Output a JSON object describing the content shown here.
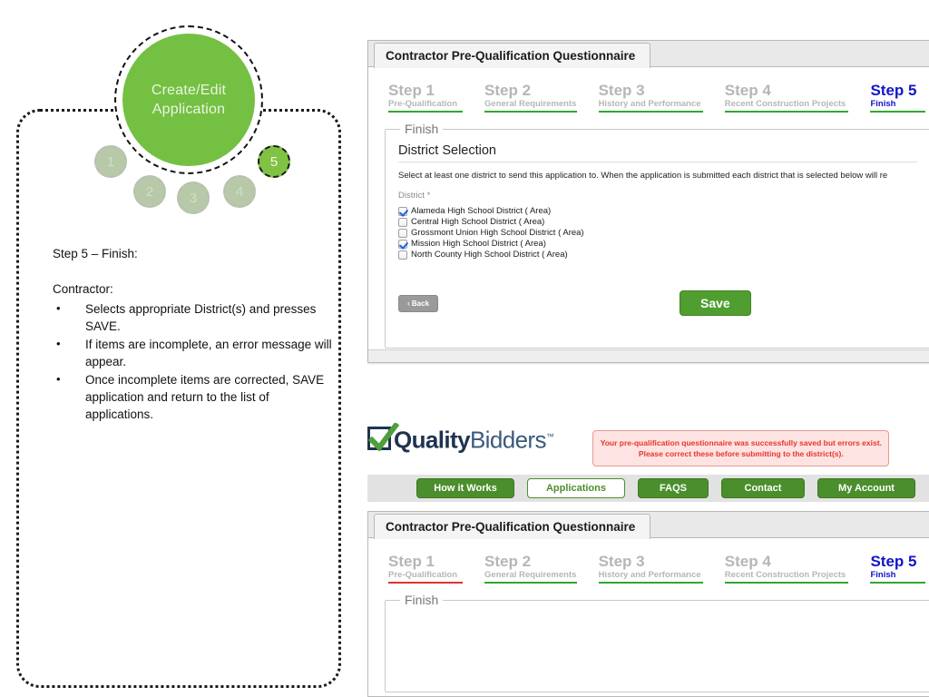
{
  "diagram": {
    "center_label_line1": "Create/Edit",
    "center_label_line2": "Application",
    "steps": [
      "1",
      "2",
      "3",
      "4",
      "5"
    ],
    "active_step": "5",
    "active_color": "#80c244",
    "inactive_color": "#b7c9a8",
    "center_color": "#74c043"
  },
  "callout": {
    "heading": "Step 5 – Finish:",
    "role": "Contractor:",
    "bullets": [
      "Selects appropriate District(s) and presses SAVE.",
      "If items are incomplete, an error message will appear.",
      "Once incomplete items are corrected, SAVE application and return to the list of applications."
    ]
  },
  "top_panel": {
    "tab_label": "Contractor Pre-Qualification Questionnaire",
    "steps": [
      {
        "title": "Step 1",
        "sub": "Pre-Qualification",
        "state": "complete"
      },
      {
        "title": "Step 2",
        "sub": "General Requirements",
        "state": "complete"
      },
      {
        "title": "Step 3",
        "sub": "History and Performance",
        "state": "complete"
      },
      {
        "title": "Step 4",
        "sub": "Recent Construction Projects",
        "state": "complete"
      },
      {
        "title": "Step 5",
        "sub": "Finish",
        "state": "current"
      }
    ],
    "fieldset_legend": "Finish",
    "section_title": "District Selection",
    "section_desc": "Select at least one district to send this application to. When the application is submitted each district that is selected below will re",
    "field_label": "District *",
    "districts": [
      {
        "label": "Alameda High School District ( Area)",
        "checked": true
      },
      {
        "label": "Central High School District ( Area)",
        "checked": false
      },
      {
        "label": "Grossmont Union High School District ( Area)",
        "checked": false
      },
      {
        "label": "Mission High School District ( Area)",
        "checked": true
      },
      {
        "label": "North County High School District ( Area)",
        "checked": false
      }
    ],
    "back_label": "‹ Back",
    "save_label": "Save"
  },
  "site": {
    "logo_quality": "Quality",
    "logo_bidders": "Bidders",
    "logo_tm": "™",
    "alert_line1": "Your pre-qualification questionnaire was successfully saved but errors exist.",
    "alert_line2": "Please correct these before submitting to the district(s).",
    "alert_text_color": "#e8352b",
    "alert_bg_color": "#fde3e1",
    "nav": [
      {
        "label": "How it Works",
        "active": false
      },
      {
        "label": "Applications",
        "active": true
      },
      {
        "label": "FAQS",
        "active": false
      },
      {
        "label": "Contact",
        "active": false
      },
      {
        "label": "My Account",
        "active": false
      }
    ]
  },
  "bottom_panel": {
    "tab_label": "Contractor Pre-Qualification Questionnaire",
    "steps": [
      {
        "title": "Step 1",
        "sub": "Pre-Qualification",
        "state": "error"
      },
      {
        "title": "Step 2",
        "sub": "General Requirements",
        "state": "complete"
      },
      {
        "title": "Step 3",
        "sub": "History and Performance",
        "state": "complete"
      },
      {
        "title": "Step 4",
        "sub": "Recent Construction Projects",
        "state": "complete"
      },
      {
        "title": "Step 5",
        "sub": "Finish",
        "state": "current"
      }
    ],
    "fieldset_legend": "Finish"
  },
  "colors": {
    "green": "#2fa82f",
    "red": "#e03232",
    "blue": "#1414c8",
    "gray": "#b6b6b6"
  }
}
